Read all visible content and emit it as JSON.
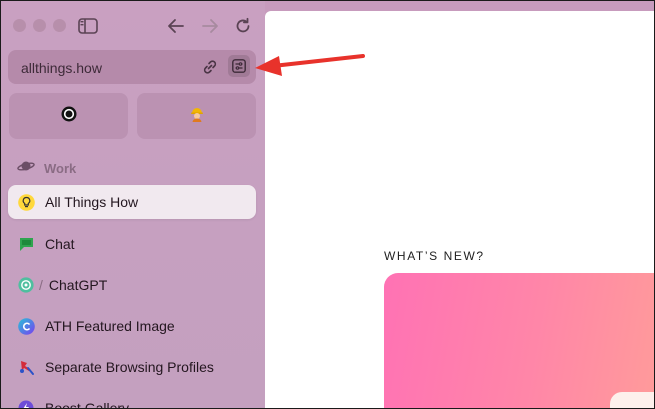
{
  "browser": {
    "url": "allthings.how",
    "colors": {
      "sidebar": "#c79bbd",
      "active_item": "#f1e9ef",
      "arrow": "#e8322b",
      "promo_start": "#ff72b4",
      "promo_end": "#ff9b9a"
    }
  },
  "toolbar": {
    "icons": [
      "sidebar-toggle-icon",
      "back-arrow-icon",
      "forward-arrow-icon",
      "reload-icon"
    ]
  },
  "urlbar": {
    "icons": [
      "link-icon",
      "site-controls-icon"
    ]
  },
  "favorites": [
    {
      "icon": "circle-app-icon"
    },
    {
      "icon": "construction-worker-icon"
    }
  ],
  "space": {
    "label": "Work",
    "icon": "planet-icon"
  },
  "tabs": [
    {
      "label": "All Things How",
      "icon": "lightbulb-icon",
      "active": true
    },
    {
      "label": "Chat",
      "icon": "chat-icon",
      "active": false
    },
    {
      "label": "ChatGPT",
      "icon": "openai-icon",
      "active": false
    },
    {
      "label": "ATH Featured Image",
      "icon": "canva-icon",
      "active": false
    },
    {
      "label": "Separate Browsing Profiles",
      "icon": "pin-icon",
      "active": false
    },
    {
      "label": "Boost Gallery",
      "icon": "boost-icon",
      "active": false
    }
  ],
  "page": {
    "whats_new": "WHAT’S NEW?"
  }
}
